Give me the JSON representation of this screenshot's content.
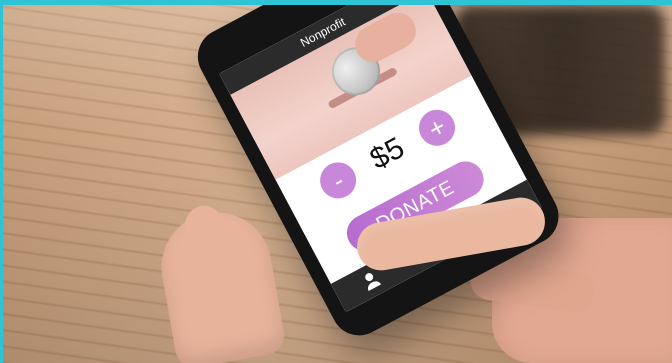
{
  "app": {
    "title": "Nonprofit"
  },
  "donation": {
    "amount": "$5",
    "minus_label": "-",
    "plus_label": "+",
    "button_label": "DONATE"
  },
  "navigation": {
    "items": [
      {
        "icon": "user-icon"
      },
      {
        "icon": "cloud-icon"
      },
      {
        "icon": "grid-icon"
      }
    ]
  },
  "colors": {
    "accent": "#c887d8",
    "header": "#2b2b2b",
    "frame": "#141414",
    "border": "#2fc3d6"
  }
}
